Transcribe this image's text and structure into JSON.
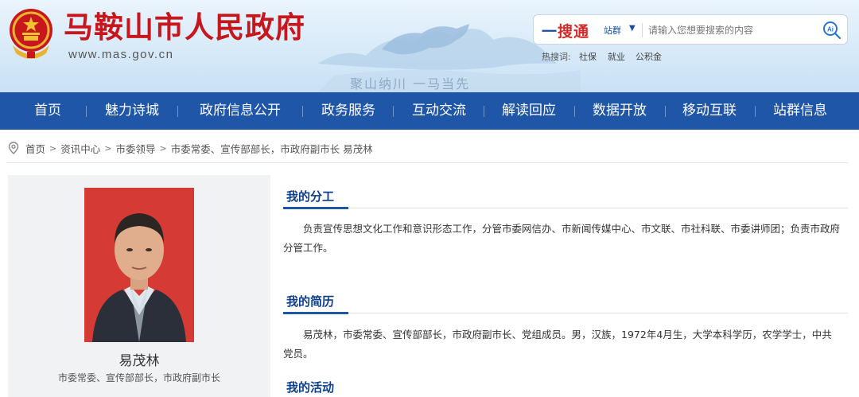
{
  "header": {
    "site_title": "马鞍山市人民政府",
    "site_url": "www.mas.gov.cn",
    "slogan": "聚山纳川 一马当先",
    "emblem_icon": "national-emblem-icon",
    "colors": {
      "title_red": "#c8161d",
      "nav_blue": "#1f56a8"
    }
  },
  "search": {
    "brand_part1": "一",
    "brand_part2": "搜通",
    "scope_label": "站群",
    "placeholder": "请输入您想要搜索的内容",
    "icon": "ai-search-icon",
    "hot_label": "热搜词:",
    "hot_words": [
      "社保",
      "就业",
      "公积金"
    ]
  },
  "nav": {
    "items": [
      "首页",
      "魅力诗城",
      "政府信息公开",
      "政务服务",
      "互动交流",
      "解读回应",
      "数据开放",
      "移动互联",
      "站群信息"
    ]
  },
  "breadcrumb": {
    "items": [
      "首页",
      "资讯中心",
      "市委领导"
    ],
    "current": "市委常委、宣传部部长，市政府副市长 易茂林",
    "separator": ">"
  },
  "profile": {
    "name": "易茂林",
    "title": "市委常委、宣传部部长，市政府副市长"
  },
  "sections": {
    "duty_title": "我的分工",
    "duty_text": "负责宣传思想文化工作和意识形态工作，分管市委网信办、市新闻传媒中心、市文联、市社科联、市委讲师团；负责市政府分管工作。",
    "bio_title": "我的简历",
    "bio_text": "易茂林，市委常委、宣传部部长，市政府副市长、党组成员。男，汉族，1972年4月生，大学本科学历，农学学士，中共党员。",
    "activity_title": "我的活动"
  }
}
